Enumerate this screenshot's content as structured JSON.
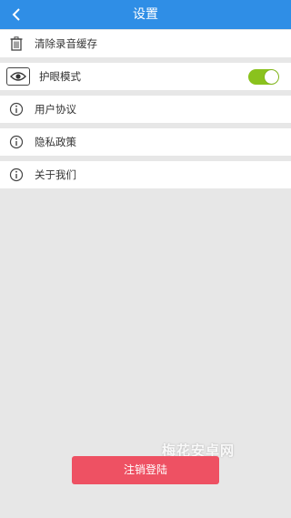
{
  "header": {
    "title": "设置",
    "back_icon": "chevron-left-icon",
    "background": "#2f8ee6"
  },
  "settings": {
    "clear_cache": {
      "label": "清除录音缓存",
      "icon": "trash-icon"
    },
    "eye_mode": {
      "label": "护眼模式",
      "icon": "eye-icon",
      "toggle_on": true
    },
    "user_agreement": {
      "label": "用户协议",
      "icon": "info-icon"
    },
    "privacy_policy": {
      "label": "隐私政策",
      "icon": "info-icon"
    },
    "about_us": {
      "label": "关于我们",
      "icon": "info-icon"
    }
  },
  "logout": {
    "label": "注销登陆",
    "color": "#ee5163"
  },
  "watermark": "梅花安卓网"
}
